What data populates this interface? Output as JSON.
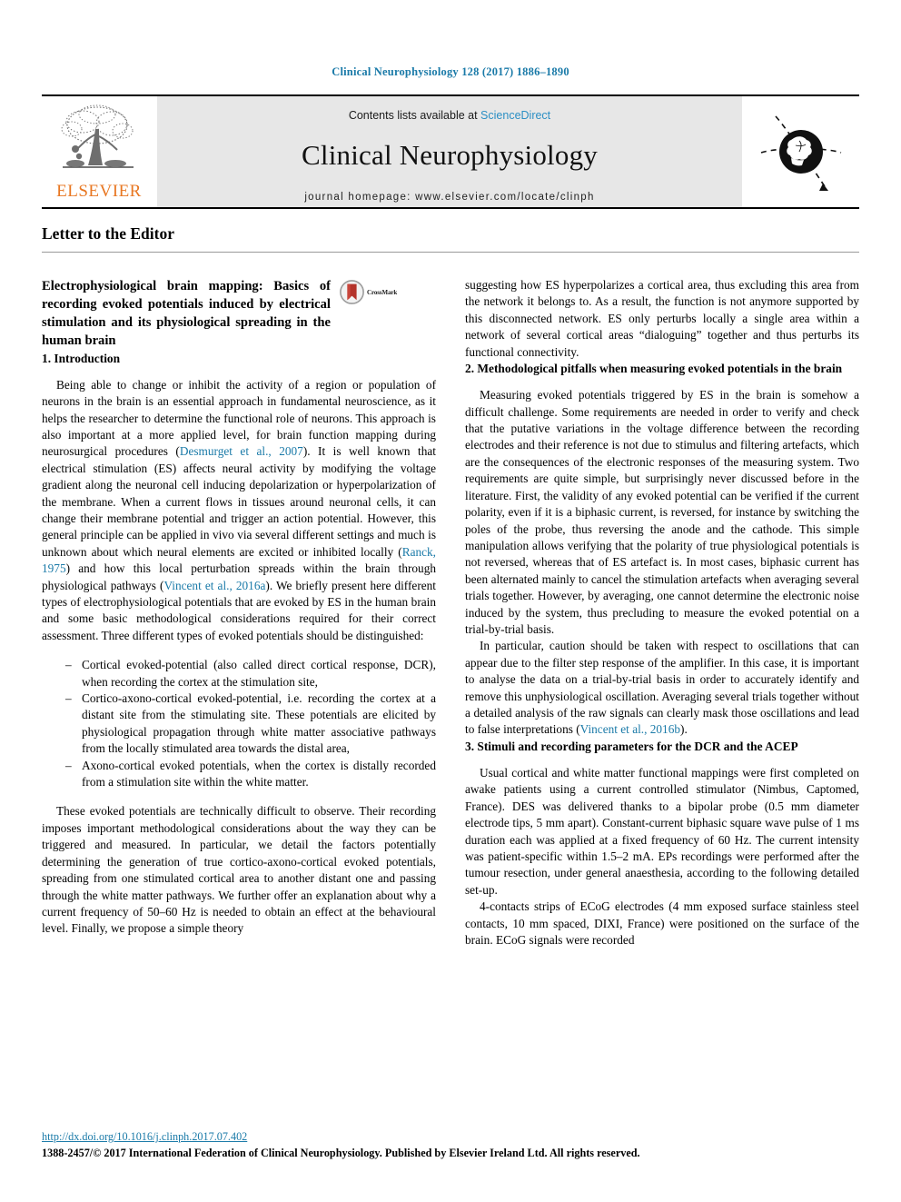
{
  "running_head": "Clinical Neurophysiology 128 (2017) 1886–1890",
  "masthead": {
    "contents_prefix": "Contents lists available at ",
    "sciencedirect": "ScienceDirect",
    "journal_title": "Clinical Neurophysiology",
    "journal_homepage": "journal homepage: www.elsevier.com/locate/clinph",
    "publisher_wordmark": "ELSEVIER",
    "publisher_color": "#e87722",
    "link_color": "#2b8fc4"
  },
  "article_type": "Letter to the Editor",
  "article": {
    "title": "Electrophysiological brain mapping: Basics of recording evoked potentials induced by electrical stimulation and its physiological spreading in the human brain",
    "crossmark_label": "CrossMark"
  },
  "left_column": {
    "section1_heading": "1. Introduction",
    "para1_a": "Being able to change or inhibit the activity of a region or population of neurons in the brain is an essential approach in fundamental neuroscience, as it helps the researcher to determine the functional role of neurons. This approach is also important at a more applied level, for brain function mapping during neurosurgical procedures (",
    "cite1": "Desmurget et al., 2007",
    "para1_b": "). It is well known that electrical stimulation (ES) affects neural activity by modifying the voltage gradient along the neuronal cell inducing depolarization or hyperpolarization of the membrane. When a current flows in tissues around neuronal cells, it can change their membrane potential and trigger an action potential. However, this general principle can be applied in vivo via several different settings and much is unknown about which neural elements are excited or inhibited locally (",
    "cite2": "Ranck, 1975",
    "para1_c": ") and how this local perturbation spreads within the brain through physiological pathways (",
    "cite3": "Vincent et al., 2016a",
    "para1_d": "). We briefly present here different types of electrophysiological potentials that are evoked by ES in the human brain and some basic methodological considerations required for their correct assessment. Three different types of evoked potentials should be distinguished:",
    "bullets": [
      "Cortical evoked-potential (also called direct cortical response, DCR), when recording the cortex at the stimulation site,",
      "Cortico-axono-cortical evoked-potential, i.e. recording the cortex at a distant site from the stimulating site. These potentials are elicited by physiological propagation through white matter associative pathways from the locally stimulated area towards the distal area,",
      "Axono-cortical evoked potentials, when the cortex is distally recorded from a stimulation site within the white matter."
    ],
    "para2": "These evoked potentials are technically difficult to observe. Their recording imposes important methodological considerations about the way they can be triggered and measured. In particular, we detail the factors potentially determining the generation of true cortico-axono-cortical evoked potentials, spreading from one stimulated cortical area to another distant one and passing through the white matter pathways. We further offer an explanation about why a current frequency of 50–60 Hz is needed to obtain an effect at the behavioural level. Finally, we propose a simple theory"
  },
  "right_column": {
    "para_top": "suggesting how ES hyperpolarizes a cortical area, thus excluding this area from the network it belongs to. As a result, the function is not anymore supported by this disconnected network. ES only perturbs locally a single area within a network of several cortical areas “dialoguing” together and thus perturbs its functional connectivity.",
    "section2_heading": "2. Methodological pitfalls when measuring evoked potentials in the brain",
    "para2_1": "Measuring evoked potentials triggered by ES in the brain is somehow a difficult challenge. Some requirements are needed in order to verify and check that the putative variations in the voltage difference between the recording electrodes and their reference is not due to stimulus and filtering artefacts, which are the consequences of the electronic responses of the measuring system. Two requirements are quite simple, but surprisingly never discussed before in the literature. First, the validity of any evoked potential can be verified if the current polarity, even if it is a biphasic current, is reversed, for instance by switching the poles of the probe, thus reversing the anode and the cathode. This simple manipulation allows verifying that the polarity of true physiological potentials is not reversed, whereas that of ES artefact is. In most cases, biphasic current has been alternated mainly to cancel the stimulation artefacts when averaging several trials together. However, by averaging, one cannot determine the electronic noise induced by the system, thus precluding to measure the evoked potential on a trial-by-trial basis.",
    "para2_2_a": "In particular, caution should be taken with respect to oscillations that can appear due to the filter step response of the amplifier. In this case, it is important to analyse the data on a trial-by-trial basis in order to accurately identify and remove this unphysiological oscillation. Averaging several trials together without a detailed analysis of the raw signals can clearly mask those oscillations and lead to false interpretations (",
    "cite4": "Vincent et al., 2016b",
    "para2_2_b": ").",
    "section3_heading": "3. Stimuli and recording parameters for the DCR and the ACEP",
    "para3_1": "Usual cortical and white matter functional mappings were first completed on awake patients using a current controlled stimulator (Nimbus, Captomed, France). DES was delivered thanks to a bipolar probe (0.5 mm diameter electrode tips, 5 mm apart). Constant-current biphasic square wave pulse of 1 ms duration each was applied at a fixed frequency of 60 Hz. The current intensity was patient-specific within 1.5–2 mA. EPs recordings were performed after the tumour resection, under general anaesthesia, according to the following detailed set-up.",
    "para3_2": "4-contacts strips of ECoG electrodes (4 mm exposed surface stainless steel contacts, 10 mm spaced, DIXI, France) were positioned on the surface of the brain. ECoG signals were recorded"
  },
  "footer": {
    "doi": "http://dx.doi.org/10.1016/j.clinph.2017.07.402",
    "copyright": "1388-2457/© 2017 International Federation of Clinical Neurophysiology. Published by Elsevier Ireland Ltd. All rights reserved."
  }
}
